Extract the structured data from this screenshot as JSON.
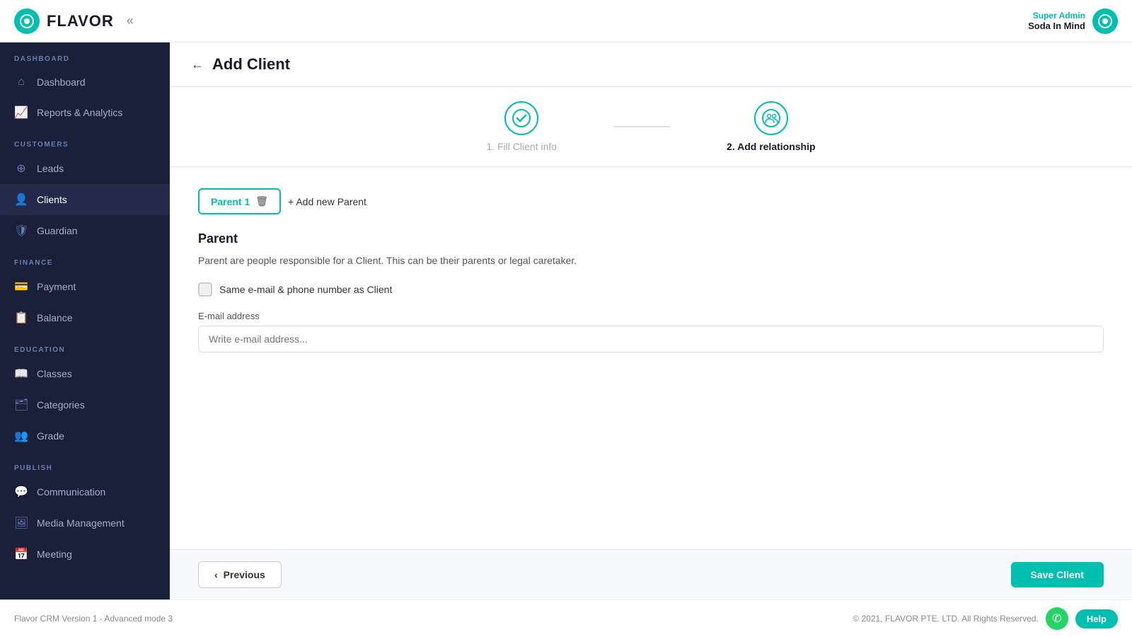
{
  "header": {
    "logo_text": "FLAVOR",
    "collapse_symbol": "«",
    "user_role": "Super Admin",
    "user_name": "Soda In Mind"
  },
  "sidebar": {
    "sections": [
      {
        "label": "DASHBOARD",
        "items": [
          {
            "id": "dashboard",
            "label": "Dashboard",
            "icon": "⌂",
            "active": false
          },
          {
            "id": "reports",
            "label": "Reports & Analytics",
            "icon": "📈",
            "active": false
          }
        ]
      },
      {
        "label": "CUSTOMERS",
        "items": [
          {
            "id": "leads",
            "label": "Leads",
            "icon": "⊕",
            "active": false
          },
          {
            "id": "clients",
            "label": "Clients",
            "icon": "👤",
            "active": true
          },
          {
            "id": "guardian",
            "label": "Guardian",
            "icon": "🛡",
            "active": false
          }
        ]
      },
      {
        "label": "FINANCE",
        "items": [
          {
            "id": "payment",
            "label": "Payment",
            "icon": "💳",
            "active": false
          },
          {
            "id": "balance",
            "label": "Balance",
            "icon": "📋",
            "active": false
          }
        ]
      },
      {
        "label": "EDUCATION",
        "items": [
          {
            "id": "classes",
            "label": "Classes",
            "icon": "📖",
            "active": false
          },
          {
            "id": "categories",
            "label": "Categories",
            "icon": "🗂",
            "active": false
          },
          {
            "id": "grade",
            "label": "Grade",
            "icon": "👥",
            "active": false
          }
        ]
      },
      {
        "label": "PUBLISH",
        "items": [
          {
            "id": "communication",
            "label": "Communication",
            "icon": "💬",
            "active": false
          },
          {
            "id": "media",
            "label": "Media Management",
            "icon": "🖼",
            "active": false
          },
          {
            "id": "meeting",
            "label": "Meeting",
            "icon": "📅",
            "active": false
          }
        ]
      }
    ]
  },
  "page": {
    "back_label": "←",
    "title": "Add Client"
  },
  "steps": [
    {
      "number": "1",
      "label": "1. Fill Client info",
      "icon": "✔",
      "state": "done"
    },
    {
      "number": "2",
      "label": "2. Add relationship",
      "icon": "👥",
      "state": "active"
    }
  ],
  "form": {
    "tab_label": "Parent 1",
    "add_parent_label": "+ Add new Parent",
    "section_title": "Parent",
    "section_desc": "Parent are people responsible for a Client. This can be their parents or legal caretaker.",
    "checkbox_label": "Same e-mail & phone number as Client",
    "email_label": "E-mail address",
    "email_placeholder": "Write e-mail address..."
  },
  "footer_form": {
    "prev_label": "Previous",
    "save_label": "Save Client"
  },
  "footer": {
    "version": "Flavor CRM Version 1 - Advanced mode 3",
    "copyright": "© 2021, FLAVOR PTE. LTD. All Rights Reserved.",
    "help_label": "Help"
  }
}
